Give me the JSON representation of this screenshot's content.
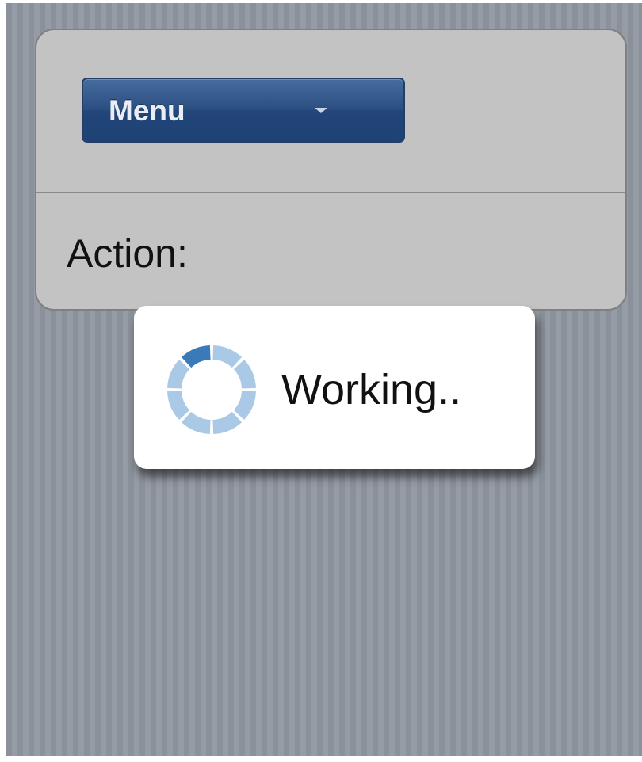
{
  "menu": {
    "label": "Menu",
    "icon": "chevron-down-icon"
  },
  "action": {
    "label": "Action:"
  },
  "loader": {
    "text": "Working..",
    "icon": "spinner-icon",
    "colors": {
      "segment": "#a9c9e6",
      "active_segment": "#3a7ab8"
    }
  },
  "colors": {
    "background": "#8e949d",
    "panel": "#c3c3c3",
    "menu_button": "#2c4f82"
  }
}
